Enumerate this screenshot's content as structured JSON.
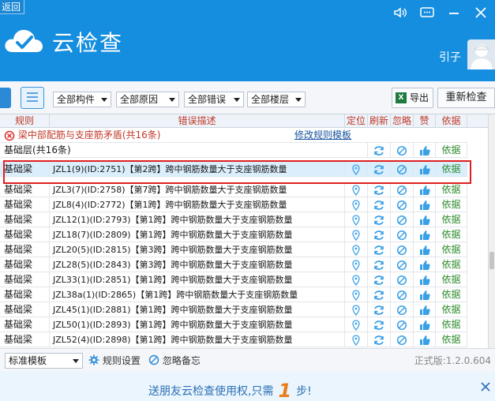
{
  "header": {
    "back_label": "返回",
    "app_title": "云检查",
    "user_name": "引子",
    "icons": [
      "speaker-icon",
      "message-icon",
      "minimize-icon",
      "close-icon"
    ]
  },
  "toolbar": {
    "filters": [
      "全部构件",
      "全部原因",
      "全部错误",
      "全部楼层"
    ],
    "export_label": "导出",
    "recheck_label": "重新检查"
  },
  "table": {
    "headers": [
      "规则",
      "错误描述",
      "定位",
      "刷新",
      "忽略",
      "赞",
      "依据"
    ],
    "group1": {
      "title": "梁中部配筋与支座筋矛盾(共16条)",
      "link": "修改规则模板"
    },
    "group2": {
      "title": "基础层(共16条)",
      "basis": "依据"
    },
    "rows": [
      {
        "rule": "基础梁",
        "desc": "JZL1(9)(ID:2751)【第2跨】跨中钢筋数量大于支座钢筋数量",
        "basis": "依据"
      },
      {
        "rule": "基础梁",
        "desc": "JZL3(7)(ID:2758)【第7跨】跨中钢筋数量大于支座钢筋数量",
        "basis": "依据"
      },
      {
        "rule": "基础梁",
        "desc": "JZL8(4)(ID:2772)【第1跨】跨中钢筋数量大于支座钢筋数量",
        "basis": "依据"
      },
      {
        "rule": "基础梁",
        "desc": "JZL12(1)(ID:2793)【第1跨】跨中钢筋数量大于支座钢筋数量",
        "basis": "依据"
      },
      {
        "rule": "基础梁",
        "desc": "JZL18(7)(ID:2809)【第1跨】跨中钢筋数量大于支座钢筋数量",
        "basis": "依据"
      },
      {
        "rule": "基础梁",
        "desc": "JZL20(5)(ID:2815)【第3跨】跨中钢筋数量大于支座钢筋数量",
        "basis": "依据"
      },
      {
        "rule": "基础梁",
        "desc": "JZL28(5)(ID:2843)【第3跨】跨中钢筋数量大于支座钢筋数量",
        "basis": "依据"
      },
      {
        "rule": "基础梁",
        "desc": "JZL33(1)(ID:2851)【第1跨】跨中钢筋数量大于支座钢筋数量",
        "basis": "依据"
      },
      {
        "rule": "基础梁",
        "desc": "JZL38a(1)(ID:2865)【第1跨】跨中钢筋数量大于支座钢筋数量",
        "basis": "依据"
      },
      {
        "rule": "基础梁",
        "desc": "JZL45(1)(ID:2881)【第1跨】跨中钢筋数量大于支座钢筋数量",
        "basis": "依据"
      },
      {
        "rule": "基础梁",
        "desc": "JZL50(1)(ID:2893)【第1跨】跨中钢筋数量大于支座钢筋数量",
        "basis": "依据"
      },
      {
        "rule": "基础梁",
        "desc": "JZL52(4)(ID:2898)【第1跨】跨中钢筋数量大于支座钢筋数量",
        "basis": "依据"
      }
    ]
  },
  "bottom": {
    "template_select": "标准模板",
    "rule_settings": "规则设置",
    "ignore_notes": "忽略备忘",
    "version": "正式版:1.2.0.604"
  },
  "banner": {
    "text_before": "送朋友云检查使用权,只需",
    "number": "1",
    "text_after": "步!"
  },
  "colors": {
    "header_blue": "#168ee0",
    "header_red_text": "#c0392b",
    "basis_green": "#2a8a2a",
    "highlight_red": "#e02020",
    "banner_orange": "#e87d1b"
  }
}
